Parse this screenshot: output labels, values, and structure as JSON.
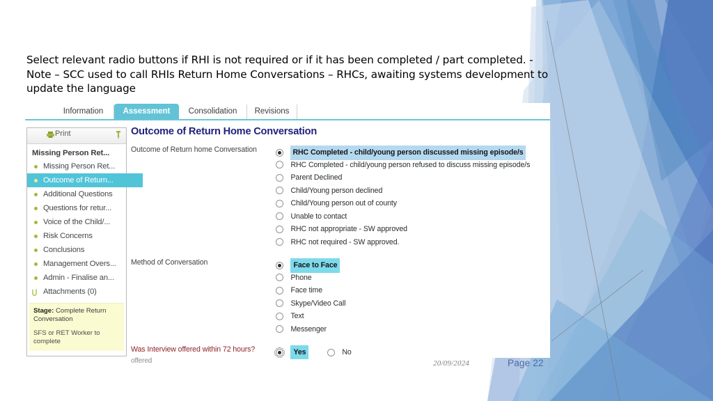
{
  "slide": {
    "body_text": "Select relevant radio buttons if RHI is not required or if it has been completed / part completed. - Note – SCC used to call RHIs Return Home Conversations – RHCs, awaiting systems development to update the language",
    "footer_date": "20/09/2024",
    "page_label": "Page 22"
  },
  "colors": {
    "tab_selected": "#63c3d6",
    "nav_selected": "#51c4d8",
    "section_title": "#21217d",
    "highlight_blue": "#b4d9ee",
    "highlight_cyan": "#7ddaea",
    "stage_box": "#fbfbd2",
    "bullet_olive": "#a5b93c",
    "alert_label": "#8e2424"
  },
  "app": {
    "tabs": [
      {
        "label": "Information",
        "selected": false
      },
      {
        "label": "Assessment",
        "selected": true
      },
      {
        "label": "Consolidation",
        "selected": false
      },
      {
        "label": "Revisions",
        "selected": false
      }
    ],
    "nav": {
      "print_label": "Print",
      "print_icon": "printer-icon",
      "pin_icon": "pushpin-icon",
      "title": "Missing Person Ret...",
      "items": [
        {
          "label": "Missing Person Ret...",
          "icon": "bullet-icon",
          "selected": false
        },
        {
          "label": "Outcome of Return...",
          "icon": "bullet-icon",
          "selected": true
        },
        {
          "label": "Additional Questions",
          "icon": "bullet-icon",
          "selected": false
        },
        {
          "label": "Questions for retur...",
          "icon": "bullet-icon",
          "selected": false
        },
        {
          "label": "Voice of the Child/...",
          "icon": "bullet-icon",
          "selected": false
        },
        {
          "label": "Risk Concerns",
          "icon": "bullet-icon",
          "selected": false
        },
        {
          "label": "Conclusions",
          "icon": "bullet-icon",
          "selected": false
        },
        {
          "label": "Management Overs...",
          "icon": "bullet-icon",
          "selected": false
        },
        {
          "label": "Admin - Finalise an...",
          "icon": "bullet-icon",
          "selected": false
        },
        {
          "label": "Attachments (0)",
          "icon": "paperclip-icon",
          "selected": false
        }
      ],
      "stage": {
        "label": "Stage:",
        "value": "Complete Return Conversation",
        "note": "SFS or RET Worker to complete"
      }
    },
    "content": {
      "section_title": "Outcome of Return Home Conversation",
      "fields": [
        {
          "label": "Outcome of Return home Conversation",
          "label_style": "normal",
          "sublabel": "",
          "layout": "stacked",
          "options": [
            {
              "label": "RHC Completed - child/young person discussed missing episode/s",
              "selected": true,
              "highlight": "blue"
            },
            {
              "label": "RHC Completed - child/young person refused to discuss missing episode/s",
              "selected": false,
              "highlight": "none"
            },
            {
              "label": "Parent Declined",
              "selected": false,
              "highlight": "none"
            },
            {
              "label": "Child/Young person declined",
              "selected": false,
              "highlight": "none"
            },
            {
              "label": "Child/Young person out of county",
              "selected": false,
              "highlight": "none"
            },
            {
              "label": "Unable to contact",
              "selected": false,
              "highlight": "none"
            },
            {
              "label": "RHC not appropriate - SW approved",
              "selected": false,
              "highlight": "none"
            },
            {
              "label": "RHC not required - SW approved.",
              "selected": false,
              "highlight": "none"
            }
          ]
        },
        {
          "label": "Method of Conversation",
          "label_style": "normal",
          "sublabel": "",
          "layout": "stacked",
          "options": [
            {
              "label": "Face to Face",
              "selected": true,
              "highlight": "cyan"
            },
            {
              "label": "Phone",
              "selected": false,
              "highlight": "none"
            },
            {
              "label": "Face time",
              "selected": false,
              "highlight": "none"
            },
            {
              "label": "Skype/Video Call",
              "selected": false,
              "highlight": "none"
            },
            {
              "label": "Text",
              "selected": false,
              "highlight": "none"
            },
            {
              "label": "Messenger",
              "selected": false,
              "highlight": "none"
            }
          ]
        },
        {
          "label": "Was Interview offered within 72 hours?",
          "label_style": "alert",
          "sublabel": "offered",
          "layout": "inline",
          "options": [
            {
              "label": "Yes",
              "selected": true,
              "highlight": "cyan",
              "focused": true
            },
            {
              "label": "No",
              "selected": false,
              "highlight": "none",
              "focused": false
            }
          ]
        }
      ]
    }
  }
}
